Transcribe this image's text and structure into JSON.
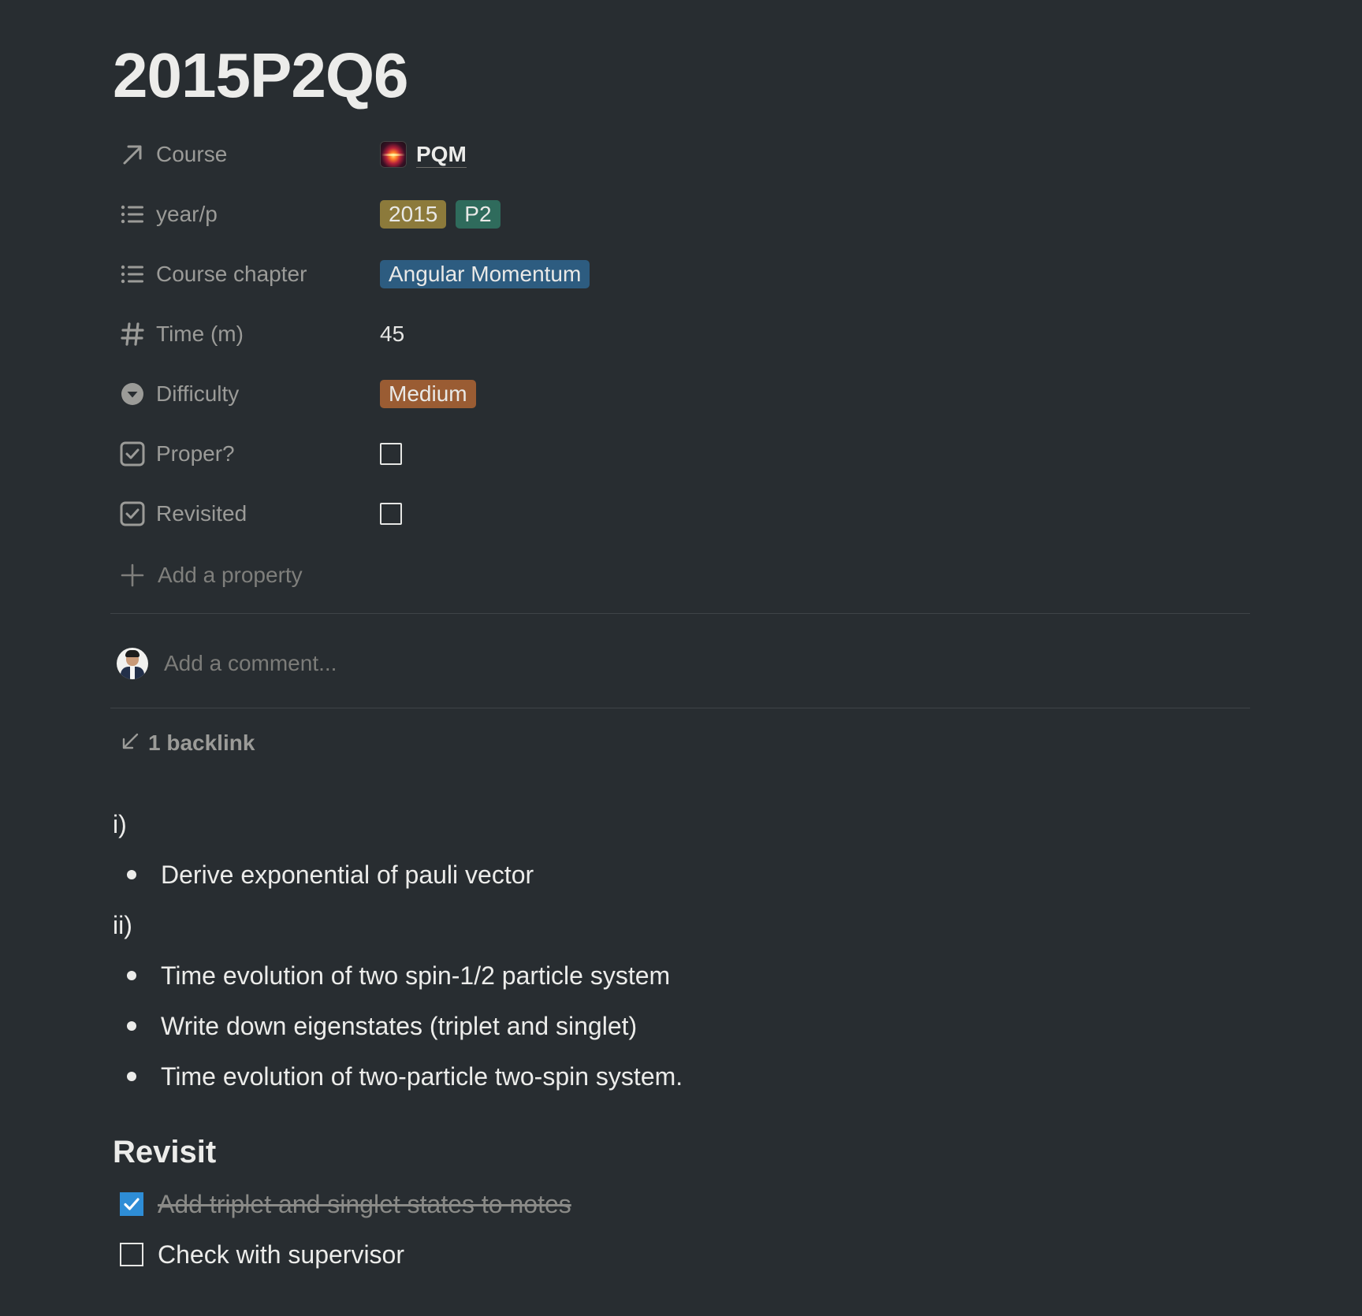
{
  "page": {
    "title": "2015P2Q6"
  },
  "properties": [
    {
      "name": "Course",
      "icon": "relation-arrow-icon",
      "type": "relation",
      "value": "PQM"
    },
    {
      "name": "year/p",
      "icon": "list-icon",
      "type": "multi_select",
      "tags": [
        {
          "label": "2015",
          "color": "#8c7a3b"
        },
        {
          "label": "P2",
          "color": "#2f6b5c"
        }
      ]
    },
    {
      "name": "Course chapter",
      "icon": "list-icon",
      "type": "multi_select",
      "tags": [
        {
          "label": "Angular Momentum",
          "color": "#2d5c80"
        }
      ]
    },
    {
      "name": "Time (m)",
      "icon": "hash-icon",
      "type": "number",
      "value": "45"
    },
    {
      "name": "Difficulty",
      "icon": "select-icon",
      "type": "select",
      "tags": [
        {
          "label": "Medium",
          "color": "#9a5c33"
        }
      ]
    },
    {
      "name": "Proper?",
      "icon": "checkbox-icon",
      "type": "checkbox",
      "checked": false
    },
    {
      "name": "Revisited",
      "icon": "checkbox-icon",
      "type": "checkbox",
      "checked": false
    }
  ],
  "add_property_label": "Add a property",
  "comment": {
    "placeholder": "Add a comment..."
  },
  "backlinks": {
    "label": "1 backlink"
  },
  "content": {
    "part1_label": "i)",
    "part1_items": [
      "Derive exponential of pauli vector"
    ],
    "part2_label": "ii)",
    "part2_items": [
      "Time evolution of two spin-1/2 particle system",
      "Write down eigenstates (triplet and singlet)",
      "Time evolution of two-particle two-spin system."
    ]
  },
  "revisit": {
    "heading": "Revisit",
    "todos": [
      {
        "text": "Add triplet and singlet states to notes",
        "checked": true
      },
      {
        "text": "Check with supervisor",
        "checked": false
      }
    ]
  },
  "colors": {
    "background": "#282d31",
    "checkbox_accent": "#2e8dd6"
  }
}
